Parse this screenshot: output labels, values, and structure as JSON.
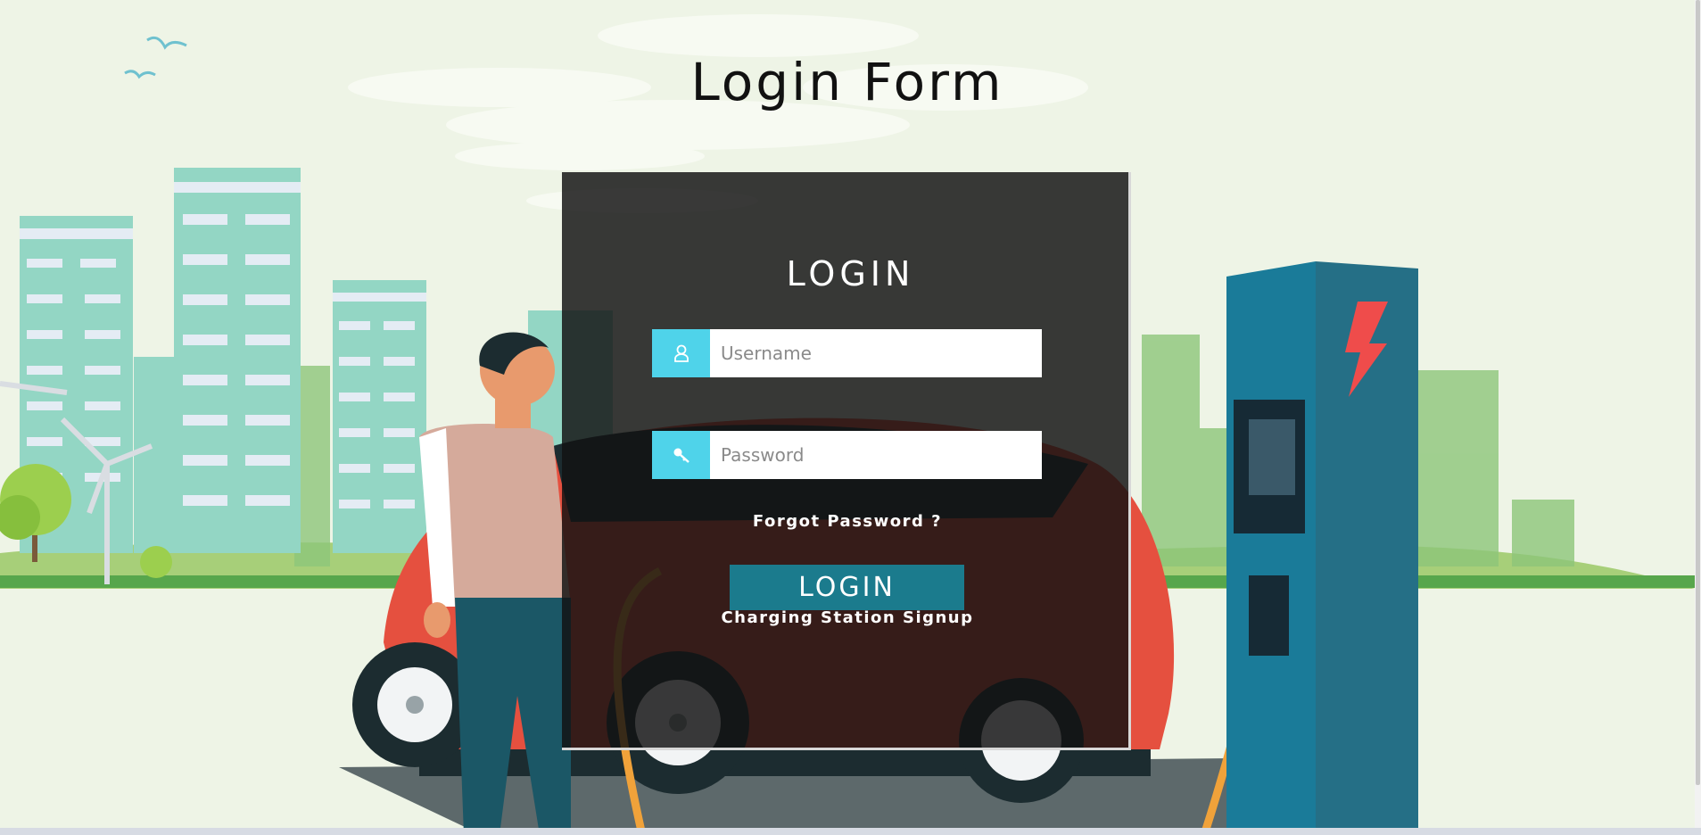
{
  "page": {
    "title": "Login Form"
  },
  "login": {
    "heading": "LOGIN",
    "username": {
      "placeholder": "Username",
      "value": "",
      "icon": "user-icon"
    },
    "password": {
      "placeholder": "Password",
      "value": "",
      "icon": "key-icon"
    },
    "forgot_label": "Forgot Password ?",
    "submit_label": "LOGIN",
    "signup_label": "Charging Station Signup"
  },
  "colors": {
    "panel": "#121212",
    "input_icon_bg": "#4fd3ea",
    "button": "#1b7b8d",
    "charger": "#1a7b99",
    "car": "#e5503f"
  }
}
